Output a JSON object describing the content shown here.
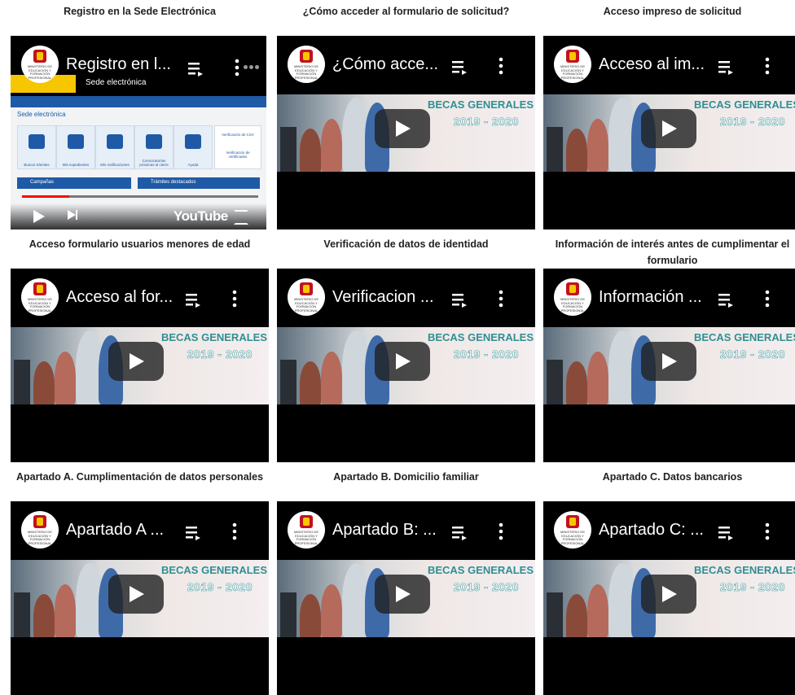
{
  "videos": [
    {
      "caption": "Registro en la Sede Electrónica",
      "title": "Registro en l..."
    },
    {
      "caption": "¿Cómo acceder al formulario de solicitud?",
      "title": "¿Cómo acce..."
    },
    {
      "caption": "Acceso impreso de solicitud",
      "title": "Acceso al im..."
    },
    {
      "caption": "Acceso formulario usuarios menores de edad",
      "title": "Acceso al for..."
    },
    {
      "caption": "Verificación de datos de identidad",
      "title": "Verificacion ..."
    },
    {
      "caption": "Información de interés antes de cumplimentar el formulario",
      "title": "Información ..."
    },
    {
      "caption": "Apartado A. Cumplimentación de datos personales",
      "title": "Apartado A ..."
    },
    {
      "caption": "Apartado B. Domicilio familiar",
      "title": "Apartado B: ..."
    },
    {
      "caption": "Apartado C. Datos bancarios",
      "title": "Apartado C: ..."
    }
  ],
  "thumbnail": {
    "banner_title": "BECAS GENERALES",
    "banner_years": "2019 - 2020"
  },
  "sede": {
    "site_title": "Sede electrónica",
    "section": "Sede electrónica",
    "tiles": [
      "Buscar trámites",
      "Mis expedientes",
      "Mis notificaciones",
      "Convocatorias próximas al cierre",
      "Ayuda"
    ],
    "csv_title": "Verificación de CSV",
    "csv_sub": "Verificación de certificados",
    "panel_left": "Campañas",
    "panel_right": "Trámites destacados",
    "progress": 0.2,
    "brand": "YouTube"
  },
  "channel_logo_text": "MINISTERIO DE EDUCACIÓN Y FORMACIÓN PROFESIONAL",
  "colors": {
    "progress": "#ff0000",
    "becas": "#2f8f92",
    "nav": "#1f5aa6"
  }
}
